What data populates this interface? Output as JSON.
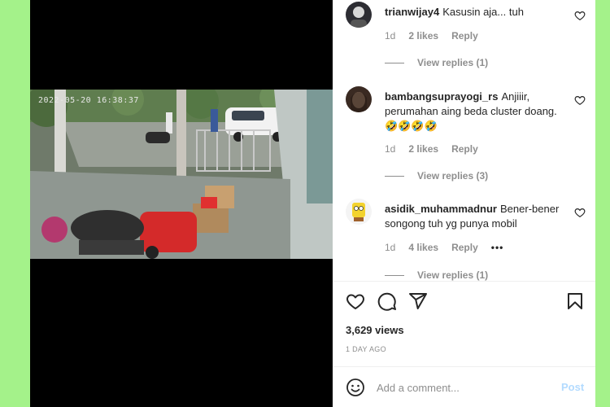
{
  "video": {
    "timestamp": "2022-05-20 16:38:37"
  },
  "comments": [
    {
      "username": "trianwijay4",
      "text": "Kasusin aja... tuh",
      "time": "1d",
      "likes": "2 likes",
      "reply_label": "Reply",
      "view_replies": "View replies (1)"
    },
    {
      "username": "bambangsuprayogi_rs",
      "text": "Anjiiir, perumahan aing beda cluster doang. 🤣🤣🤣🤣",
      "time": "1d",
      "likes": "2 likes",
      "reply_label": "Reply",
      "view_replies": "View replies (3)"
    },
    {
      "username": "asidik_muhammadnur",
      "text": "Bener-bener songong tuh yg punya mobil",
      "time": "1d",
      "likes": "4 likes",
      "reply_label": "Reply",
      "more": "•••",
      "view_replies": "View replies (1)"
    }
  ],
  "post": {
    "views": "3,629 views",
    "time_ago": "1 DAY AGO"
  },
  "comment_box": {
    "placeholder": "Add a comment...",
    "post_label": "Post"
  },
  "colors": {
    "background": "#a4f28a",
    "link": "#b3dbff",
    "muted": "#8e8e8e",
    "text": "#262626"
  },
  "icons": [
    "heart-icon",
    "comment-icon",
    "share-icon",
    "bookmark-icon",
    "emoji-icon"
  ]
}
